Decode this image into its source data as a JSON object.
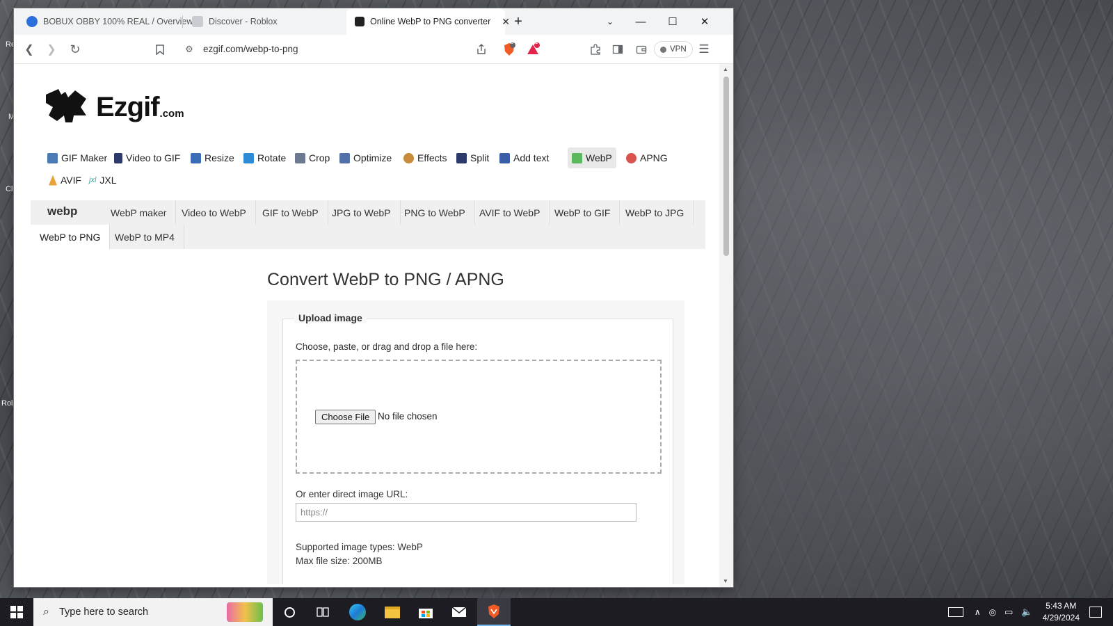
{
  "desktop": {
    "labels": [
      "Re",
      "M",
      "Cl",
      "Rol"
    ]
  },
  "browser": {
    "tabs": [
      {
        "title": "BOBUX OBBY 100% REAL / Overview",
        "active": false
      },
      {
        "title": "Discover - Roblox",
        "active": false
      },
      {
        "title": "Online WebP to PNG converter",
        "active": true
      }
    ],
    "url": "ezgif.com/webp-to-png",
    "shields_count": "5",
    "rewards_count": "1",
    "vpn_label": "VPN"
  },
  "site": {
    "logo_text": "Ezgif",
    "logo_suffix": ".com",
    "main_nav": [
      {
        "label": "GIF Maker",
        "icon": "gif-maker-icon",
        "color": "#4a7bb5"
      },
      {
        "label": "Video to GIF",
        "icon": "film-icon",
        "color": "#2b3a6b"
      },
      {
        "label": "Resize",
        "icon": "resize-icon",
        "color": "#3a6db5"
      },
      {
        "label": "Rotate",
        "icon": "rotate-icon",
        "color": "#2e8bd6"
      },
      {
        "label": "Crop",
        "icon": "crop-icon",
        "color": "#6b7a8f"
      },
      {
        "label": "Optimize",
        "icon": "optimize-icon",
        "color": "#5470a8"
      },
      {
        "label": "Effects",
        "icon": "effects-icon",
        "color": "#c78b3a"
      },
      {
        "label": "Split",
        "icon": "split-icon",
        "color": "#2b3a6b"
      },
      {
        "label": "Add text",
        "icon": "add-text-icon",
        "color": "#3b5ea8"
      },
      {
        "label": "WebP",
        "icon": "webp-icon",
        "color": "#5cb85c"
      },
      {
        "label": "APNG",
        "icon": "apng-icon",
        "color": "#d9534f"
      },
      {
        "label": "AVIF",
        "icon": "avif-icon",
        "color": "#e8a33a"
      },
      {
        "label": "JXL",
        "icon": "jxl-icon",
        "color": "#3aa89b"
      }
    ],
    "webp_logo": "webp",
    "sub_nav": [
      "WebP maker",
      "Video to WebP",
      "GIF to WebP",
      "JPG to WebP",
      "PNG to WebP",
      "AVIF to WebP",
      "WebP to GIF",
      "WebP to JPG",
      "WebP to PNG",
      "WebP to MP4"
    ],
    "active_sub": "WebP to PNG"
  },
  "converter": {
    "title": "Convert WebP to PNG / APNG",
    "legend": "Upload image",
    "choose_label": "Choose, paste, or drag and drop a file here:",
    "choose_button": "Choose File",
    "no_file": "No file chosen",
    "url_label": "Or enter direct image URL:",
    "url_placeholder": "https://",
    "supported": "Supported image types: WebP",
    "max_size": "Max file size: 200MB"
  },
  "taskbar": {
    "search_placeholder": "Type here to search",
    "time": "5:43 AM",
    "date": "4/29/2024"
  }
}
